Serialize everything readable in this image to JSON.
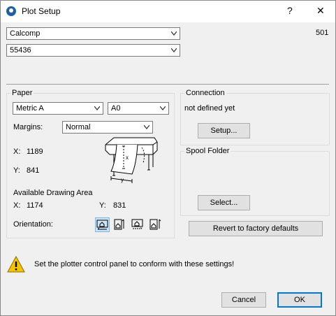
{
  "window": {
    "title": "Plot Setup",
    "help": "?",
    "close": "✕"
  },
  "plotter": {
    "selected": "Calcomp",
    "model": "55436",
    "number": "501"
  },
  "paper": {
    "group_title": "Paper",
    "standard": "Metric A",
    "size": "A0",
    "margins_label": "Margins:",
    "margins_value": "Normal",
    "x_label": "X:",
    "x_value": "1189",
    "y_label": "Y:",
    "y_value": "841",
    "area_title": "Available Drawing Area",
    "area_x_label": "X:",
    "area_x_value": "1174",
    "area_y_label": "Y:",
    "area_y_value": "831",
    "orientation_label": "Orientation:"
  },
  "connection": {
    "group_title": "Connection",
    "status": "not defined yet",
    "setup_button": "Setup..."
  },
  "spool": {
    "group_title": "Spool Folder",
    "select_button": "Select..."
  },
  "revert_button": "Revert to factory defaults",
  "warning_text": "Set the plotter control panel to conform with these settings!",
  "footer": {
    "cancel": "Cancel",
    "ok": "OK"
  },
  "icons": {
    "app": "archicad-logo-icon",
    "dropdown": "chevron-down-icon",
    "warning": "warning-icon"
  }
}
